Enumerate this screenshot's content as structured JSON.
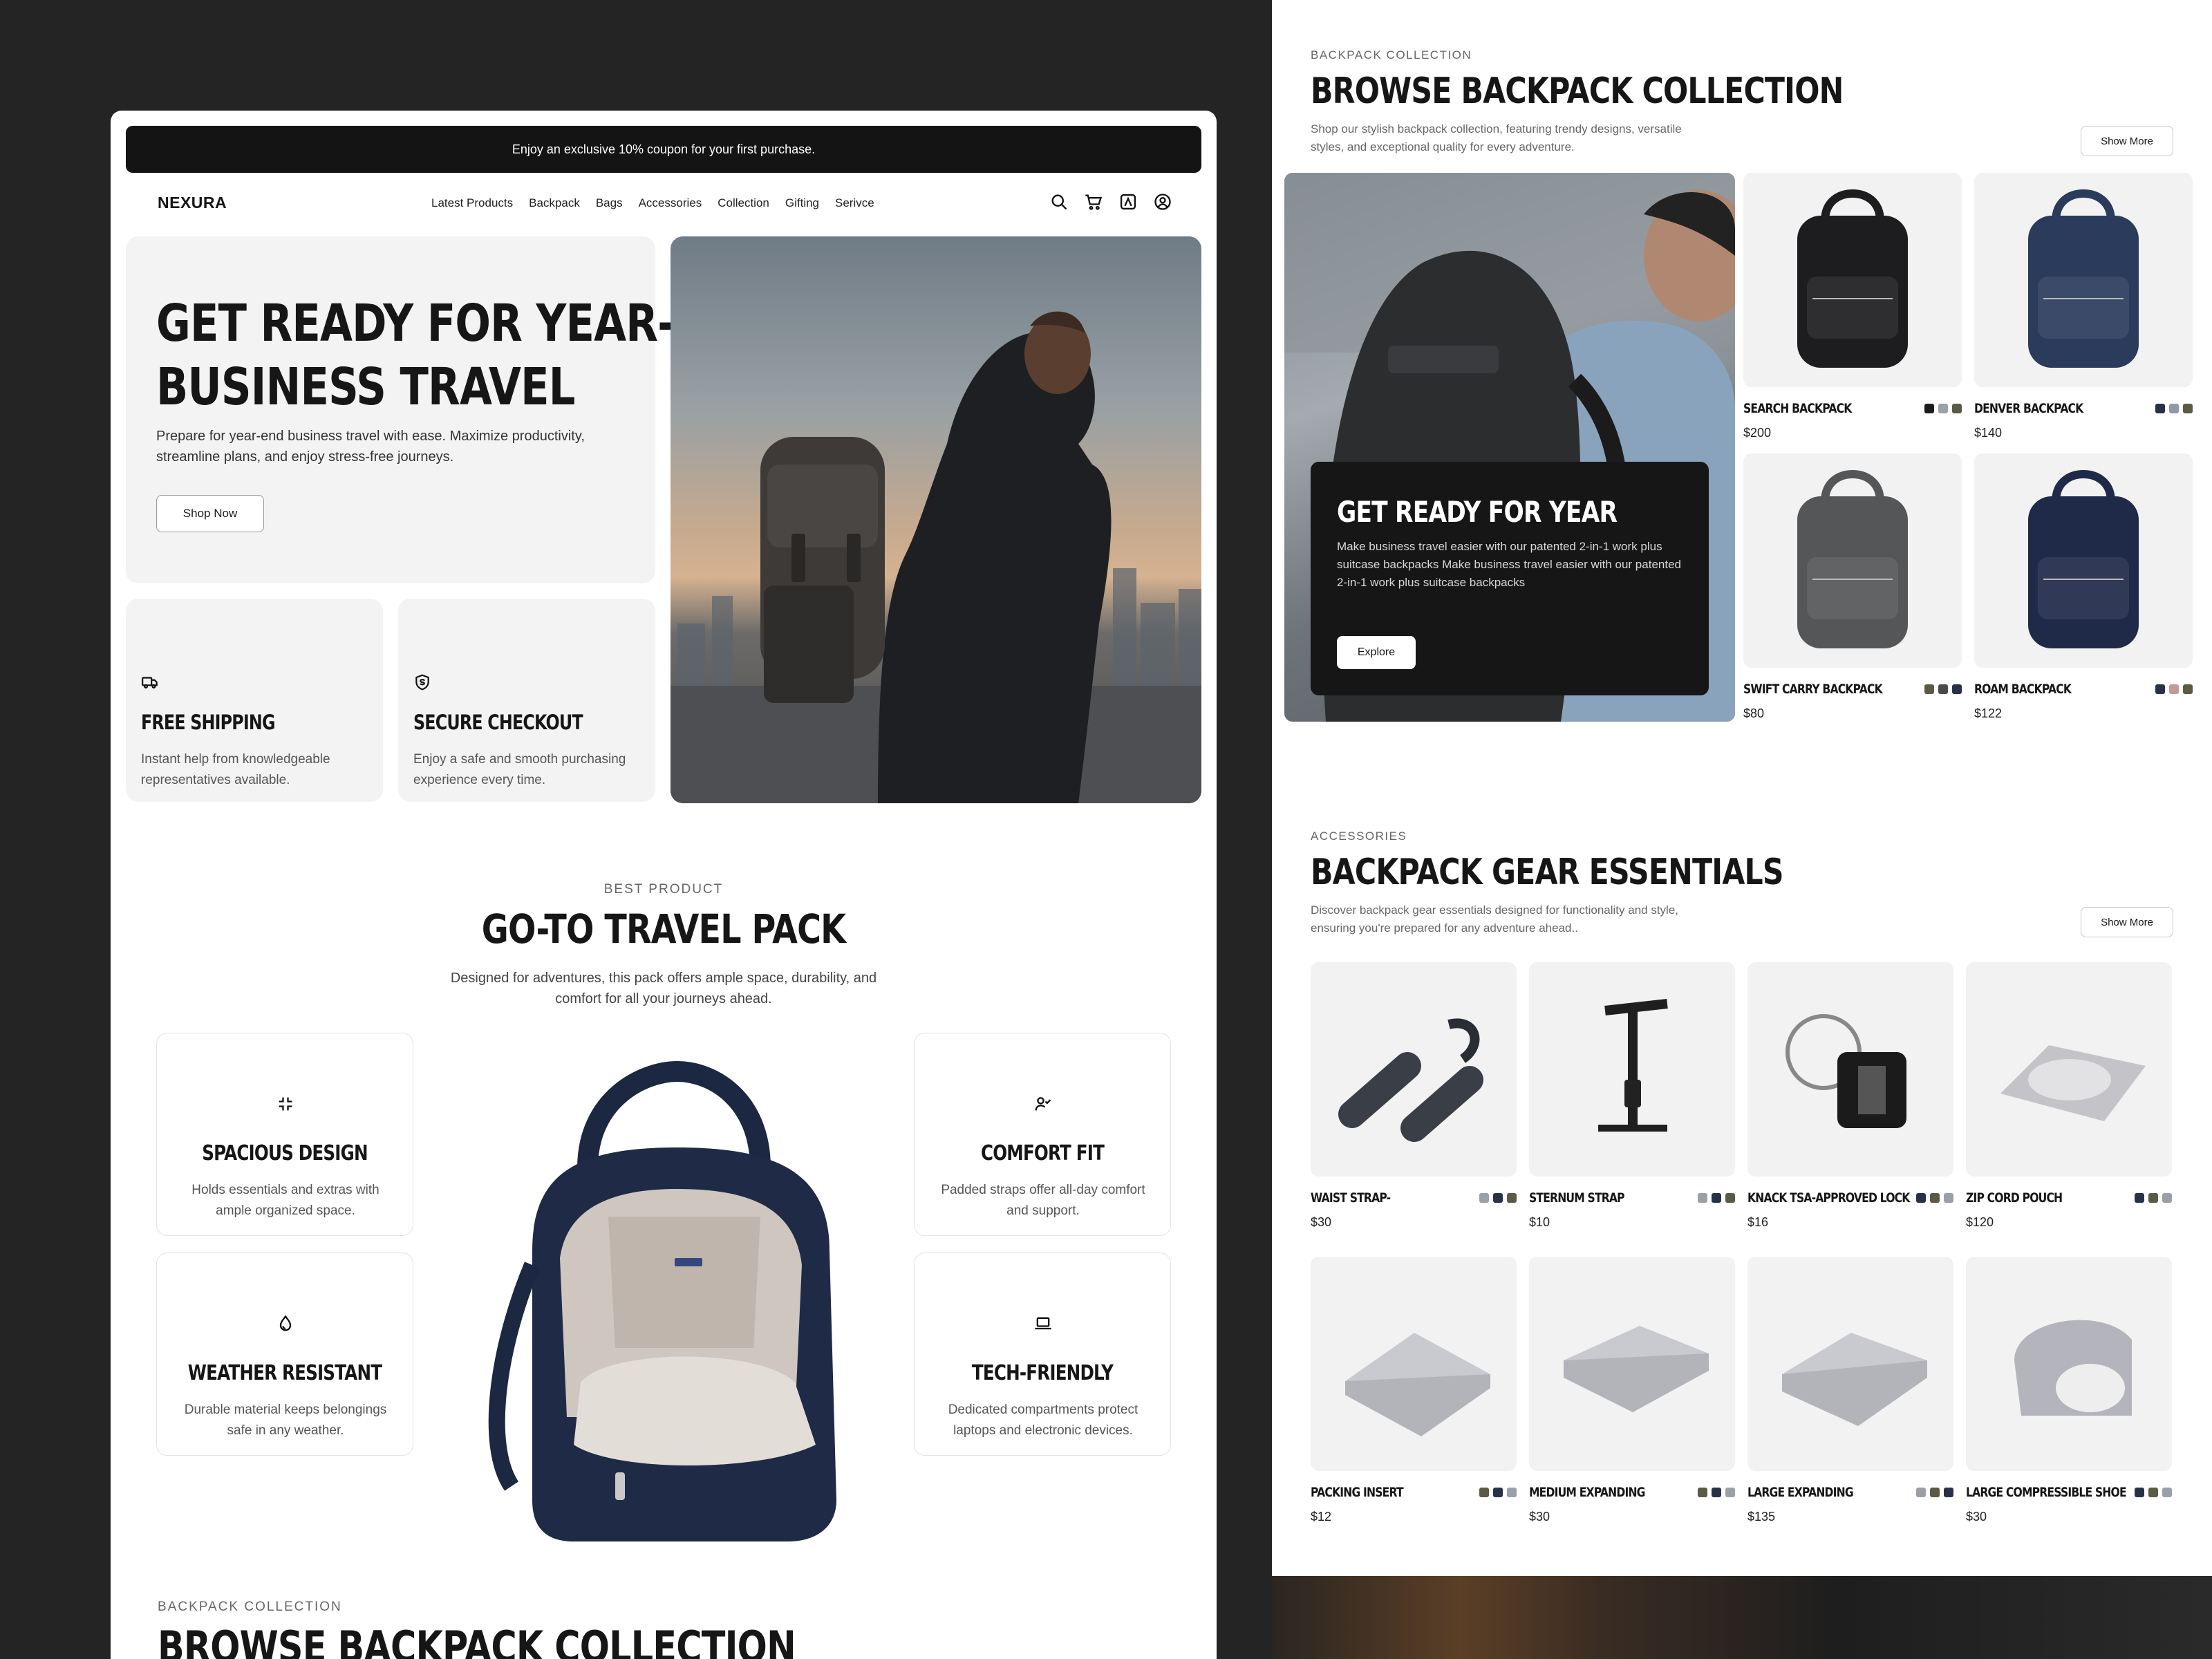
{
  "promo": "Enjoy an exclusive 10% coupon for your first purchase.",
  "brand": "NEXURA",
  "nav": [
    "Latest Products",
    "Backpack",
    "Bags",
    "Accessories",
    "Collection",
    "Gifting",
    "Serivce"
  ],
  "header_icons": [
    "search-icon",
    "cart-icon",
    "bookmark-icon",
    "account-icon"
  ],
  "hero": {
    "title_line1": "GET READY FOR YEAR-END",
    "title_line2": "BUSINESS TRAVEL",
    "subtitle": "Prepare for year-end business travel with ease. Maximize productivity, streamline plans, and enjoy stress-free journeys.",
    "cta": "Shop Now"
  },
  "features": [
    {
      "icon": "truck-icon",
      "title": "FREE SHIPPING",
      "desc": "Instant help from knowledgeable representatives available."
    },
    {
      "icon": "shield-icon",
      "title": "SECURE CHECKOUT",
      "desc": "Enjoy a safe and smooth purchasing experience every time."
    }
  ],
  "best": {
    "eyebrow": "BEST PRODUCT",
    "title": "GO-TO TRAVEL PACK",
    "subtitle": "Designed for adventures, this pack offers ample space, durability, and comfort for all your journeys ahead.",
    "specs": [
      {
        "icon": "collapse-icon",
        "title": "SPACIOUS DESIGN",
        "desc": "Holds essentials and extras with ample organized space."
      },
      {
        "icon": "user-check-icon",
        "title": "COMFORT FIT",
        "desc": "Padded straps offer all-day comfort and support."
      },
      {
        "icon": "drop-icon",
        "title": "WEATHER RESISTANT",
        "desc": "Durable material keeps belongings safe in any weather."
      },
      {
        "icon": "laptop-icon",
        "title": "TECH-FRIENDLY",
        "desc": "Dedicated compartments protect laptops and electronic devices."
      }
    ]
  },
  "left_collection": {
    "eyebrow": "BACKPACK COLLECTION",
    "title": "BROWSE BACKPACK COLLECTION"
  },
  "backpacks": {
    "eyebrow": "BACKPACK COLLECTION",
    "title": "BROWSE BACKPACK COLLECTION",
    "subtitle": "Shop our stylish backpack collection, featuring trendy designs, versatile styles, and exceptional quality for every adventure.",
    "show_more": "Show More",
    "promo_card": {
      "title": "GET READY FOR YEAR",
      "desc": "Make business travel easier with our patented 2-in-1 work plus suitcase backpacks Make business travel easier with our patented 2-in-1 work plus suitcase backpacks",
      "cta": "Explore"
    },
    "items": [
      {
        "name": "SEARCH BACKPACK",
        "price": "$200",
        "colors": [
          "#1c1c1c",
          "#9aa0a6",
          "#5b5a45"
        ],
        "bag": "#1d1d1f"
      },
      {
        "name": "DENVER BACKPACK",
        "price": "$140",
        "colors": [
          "#273248",
          "#8f98a3",
          "#5b5a45"
        ],
        "bag": "#2a3b5c"
      },
      {
        "name": "SWIFT CARRY BACKPACK",
        "price": "$80",
        "colors": [
          "#5b5a45",
          "#4a4a4a",
          "#273248"
        ],
        "bag": "#555658"
      },
      {
        "name": "ROAM BACKPACK",
        "price": "$122",
        "colors": [
          "#273248",
          "#c29a9a",
          "#5b5a45"
        ],
        "bag": "#1f2a48"
      }
    ]
  },
  "accessories": {
    "eyebrow": "ACCESSORIES",
    "title": "BACKPACK GEAR ESSENTIALS",
    "subtitle": "Discover backpack gear essentials designed for functionality and style, ensuring you're prepared for any adventure ahead..",
    "show_more": "Show More",
    "items": [
      {
        "name": "WAIST STRAP-",
        "price": "$30",
        "colors": [
          "#9aa0a6",
          "#273248",
          "#5b5a45"
        ]
      },
      {
        "name": "STERNUM STRAP",
        "price": "$10",
        "colors": [
          "#9aa0a6",
          "#273248",
          "#5b5a45"
        ]
      },
      {
        "name": "KNACK TSA-APPROVED LOCK",
        "price": "$16",
        "colors": [
          "#273248",
          "#5b5a45",
          "#9aa0a6"
        ]
      },
      {
        "name": "ZIP CORD POUCH",
        "price": "$120",
        "colors": [
          "#273248",
          "#5b5a45",
          "#9aa0a6"
        ]
      },
      {
        "name": "PACKING INSERT",
        "price": "$12",
        "colors": [
          "#5b5a45",
          "#273248",
          "#9aa0a6"
        ]
      },
      {
        "name": "MEDIUM EXPANDING",
        "price": "$30",
        "colors": [
          "#5b5a45",
          "#273248",
          "#9aa0a6"
        ]
      },
      {
        "name": "LARGE EXPANDING",
        "price": "$135",
        "colors": [
          "#9aa0a6",
          "#5b5a45",
          "#273248"
        ]
      },
      {
        "name": "LARGE COMPRESSIBLE SHOE",
        "price": "$30",
        "colors": [
          "#273248",
          "#5b5a45",
          "#9aa0a6"
        ]
      }
    ]
  }
}
